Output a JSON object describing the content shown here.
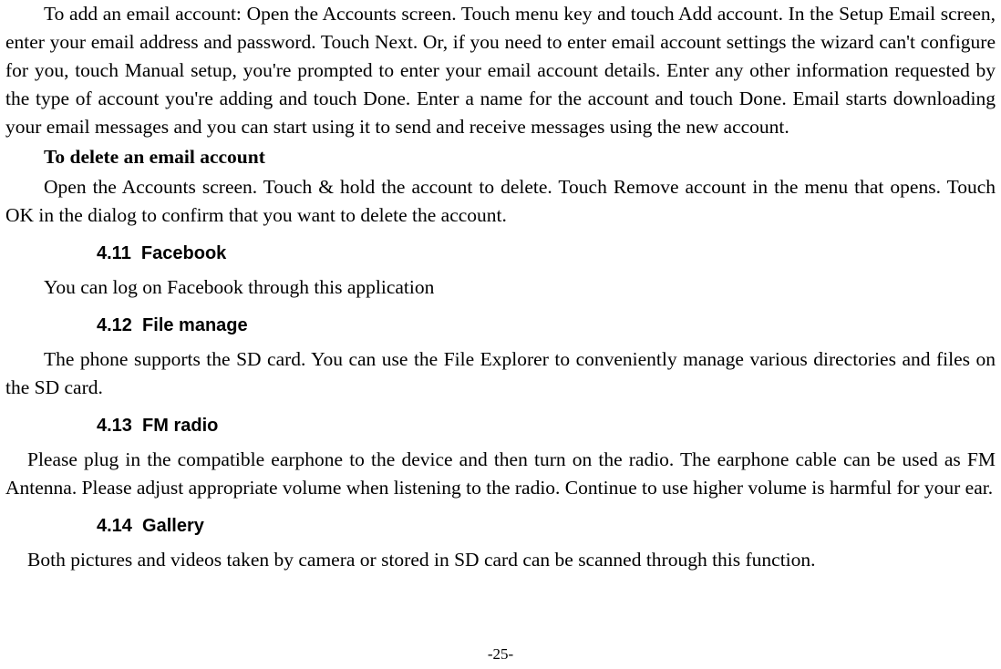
{
  "paragraphs": {
    "add_account": "To add an email account: Open the Accounts screen. Touch menu key and touch Add account. In the Setup Email screen, enter your email address and password. Touch Next. Or, if you need to enter email account settings the wizard can't configure for you, touch Manual setup, you're prompted to enter your email account details. Enter any other information requested by the type of account you're adding and touch Done. Enter a name for the account and touch Done. Email starts downloading your email messages and you can start using it to send and receive messages using the new account.",
    "delete_heading": "To delete an email account",
    "delete_body": "Open the Accounts screen. Touch & hold the account to delete. Touch Remove account in the menu that opens. Touch OK in the dialog to confirm that you want to delete the account.",
    "facebook_body": "You can log on Facebook through this application",
    "file_body": "The phone supports the SD card. You can use the File Explorer to conveniently manage various directories and files on the SD card.",
    "fm_body": "Please plug in the compatible earphone to the device and then turn on the radio. The earphone cable can be used as FM Antenna. Please adjust appropriate volume when listening to the radio. Continue to use higher volume is harmful for your ear.",
    "gallery_body": "Both pictures and videos taken by camera or stored in SD card can be scanned through this function."
  },
  "headings": {
    "h411": "4.11  Facebook",
    "h412": "4.12  File manage",
    "h413": "4.13  FM radio",
    "h414": "4.14  Gallery"
  },
  "page_number": "-25-"
}
